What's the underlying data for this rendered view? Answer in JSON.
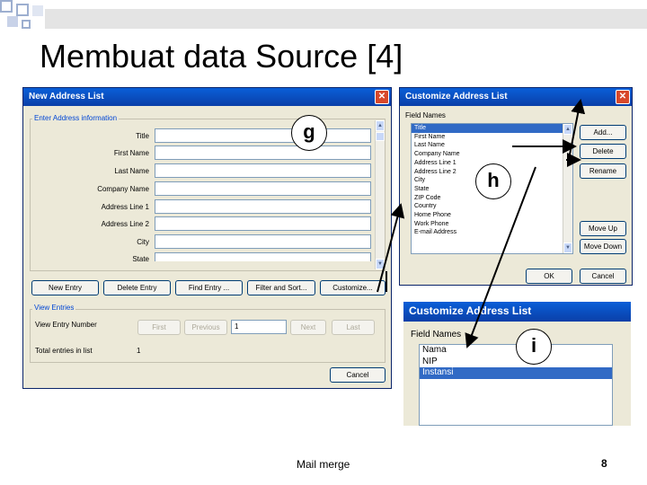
{
  "slide": {
    "title": "Membuat data Source [4]",
    "footer_text": "Mail merge",
    "page_number": "8"
  },
  "new_address_dialog": {
    "title": "New Address List",
    "close_glyph": "✕",
    "enter_info_label": "Enter Address information",
    "fields": [
      {
        "label": "Title",
        "value": ""
      },
      {
        "label": "First Name",
        "value": ""
      },
      {
        "label": "Last Name",
        "value": ""
      },
      {
        "label": "Company Name",
        "value": ""
      },
      {
        "label": "Address Line 1",
        "value": ""
      },
      {
        "label": "Address Line 2",
        "value": ""
      },
      {
        "label": "City",
        "value": ""
      },
      {
        "label": "State",
        "value": ""
      }
    ],
    "buttons": {
      "new_entry": "New Entry",
      "delete_entry": "Delete Entry",
      "find_entry": "Find Entry ...",
      "filter_sort": "Filter and Sort...",
      "customize": "Customize..."
    },
    "view_entries_label": "View Entries",
    "view_entry_number_label": "View Entry Number",
    "nav": {
      "first": "First",
      "previous": "Previous",
      "entry_number": "1",
      "next": "Next",
      "last": "Last"
    },
    "total_entries_label": "Total entries in list",
    "total_entries_value": "1",
    "cancel": "Cancel"
  },
  "customize_dialog": {
    "title": "Customize Address List",
    "close_glyph": "✕",
    "field_names_label": "Field Names",
    "field_names": [
      "Title",
      "First Name",
      "Last Name",
      "Company Name",
      "Address Line 1",
      "Address Line 2",
      "City",
      "State",
      "ZIP Code",
      "Country",
      "Home Phone",
      "Work Phone",
      "E-mail Address"
    ],
    "selected_index": 0,
    "buttons": {
      "add": "Add...",
      "delete": "Delete",
      "rename": "Rename",
      "move_up": "Move Up",
      "move_down": "Move Down",
      "ok": "OK",
      "cancel": "Cancel"
    }
  },
  "customize_result": {
    "title": "Customize Address List",
    "field_names_label": "Field Names",
    "field_names": [
      "Nama",
      "NIP",
      "Instansi"
    ],
    "selected_index": 2
  },
  "callouts": {
    "g": "g",
    "h": "h",
    "i": "i"
  },
  "colors": {
    "titlebar": "#0a4fc8",
    "dialog_bg": "#ece9d8",
    "selection": "#316ac5",
    "decor_blue": "#9dafd0"
  },
  "icons": {
    "scroll_up": "▲",
    "scroll_down": "▼"
  }
}
